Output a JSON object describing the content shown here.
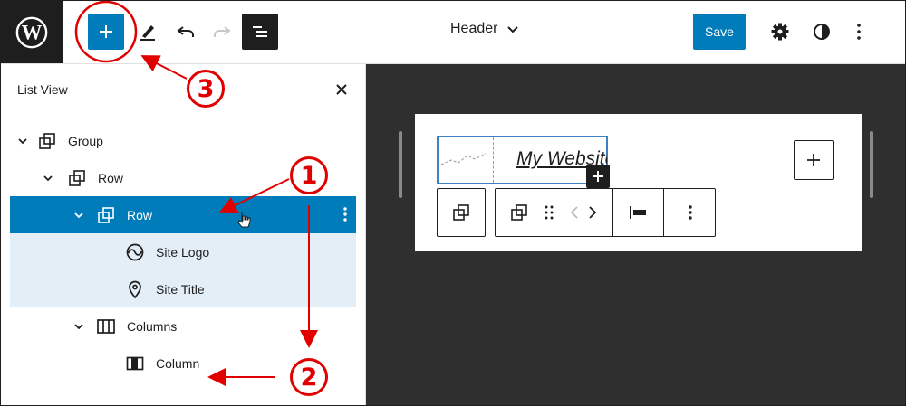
{
  "topbar": {
    "document_title": "Header",
    "save_label": "Save",
    "icons": [
      "wordpress-icon",
      "plus-icon",
      "pencil-icon",
      "undo-icon",
      "redo-icon",
      "list-view-icon",
      "chevron-down-icon",
      "gear-icon",
      "contrast-icon",
      "more-vertical-icon"
    ]
  },
  "list_view": {
    "title": "List View",
    "items": [
      {
        "label": "Group",
        "depth": 0,
        "icon": "group-icon",
        "expanded": true
      },
      {
        "label": "Row",
        "depth": 1,
        "icon": "row-icon",
        "expanded": true
      },
      {
        "label": "Row",
        "depth": 2,
        "icon": "row-icon",
        "expanded": true,
        "selected": true
      },
      {
        "label": "Site Logo",
        "depth": 3,
        "icon": "site-logo-icon"
      },
      {
        "label": "Site Title",
        "depth": 3,
        "icon": "map-pin-icon"
      },
      {
        "label": "Columns",
        "depth": 2,
        "icon": "columns-icon",
        "expanded": true
      },
      {
        "label": "Column",
        "depth": 3,
        "icon": "column-icon"
      }
    ]
  },
  "canvas": {
    "site_title": "My Website"
  },
  "annotations": {
    "labels": [
      "1",
      "2",
      "3"
    ],
    "color": "#e00000"
  },
  "colors": {
    "accent": "#007cba",
    "dark": "#1e1e1e",
    "canvas_bg": "#2f2f2f",
    "selected_child_bg": "#e4eef6"
  }
}
